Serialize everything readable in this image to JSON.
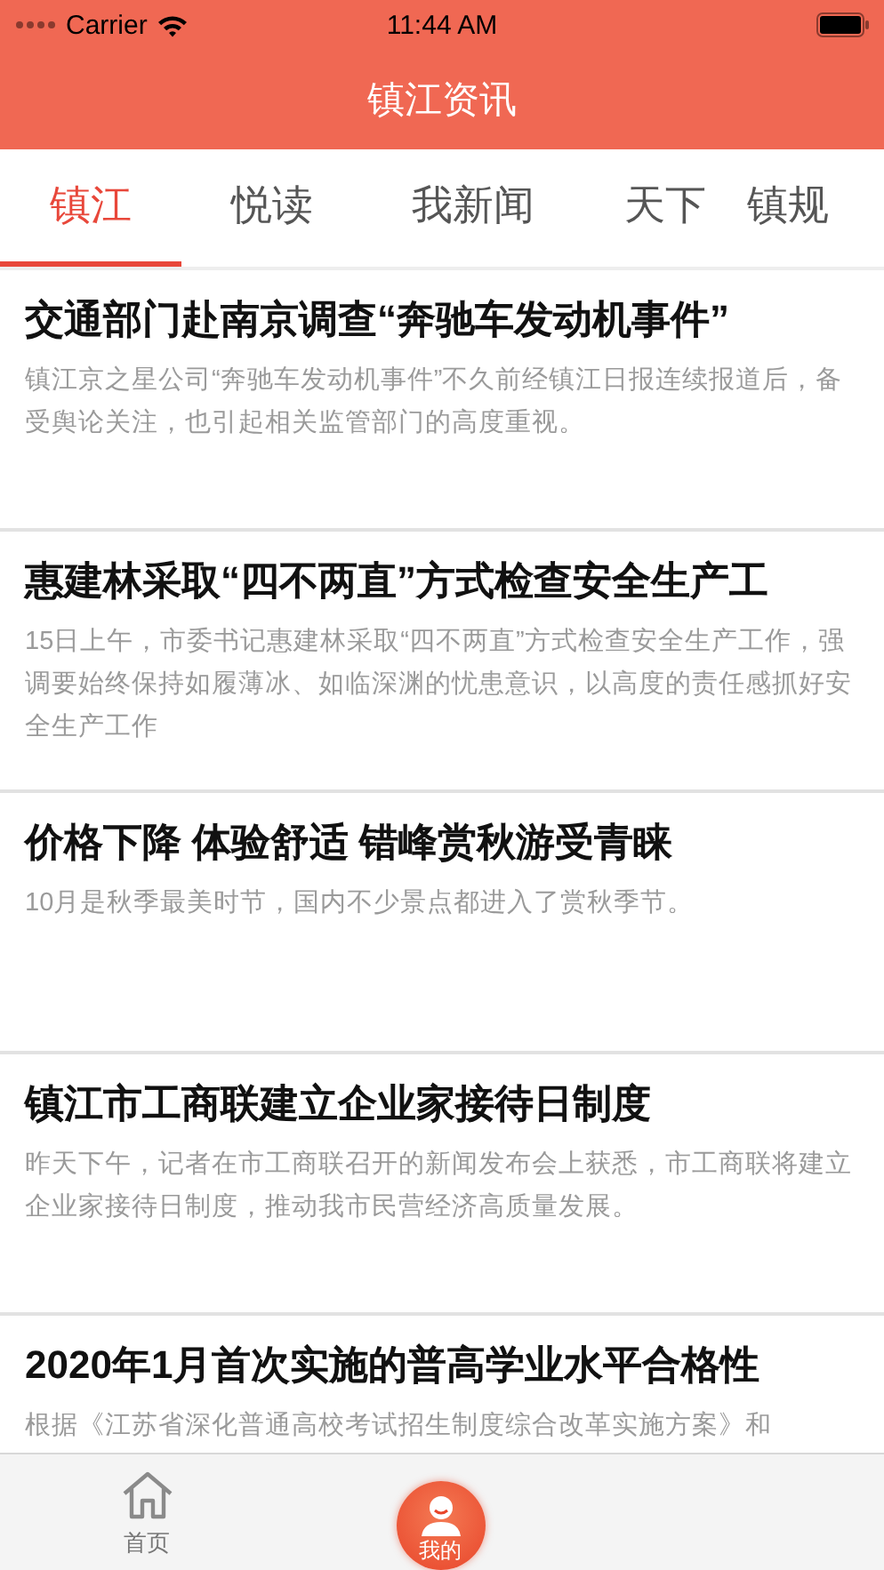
{
  "status_bar": {
    "carrier": "Carrier",
    "time": "11:44 AM"
  },
  "nav": {
    "title": "镇江资讯"
  },
  "tabs": [
    {
      "label": "镇江",
      "selected": true
    },
    {
      "label": "悦读",
      "selected": false
    },
    {
      "label": "我新闻",
      "selected": false
    },
    {
      "label": "天下",
      "selected": false
    },
    {
      "label": "镇规",
      "selected": false
    }
  ],
  "articles": [
    {
      "title": "交通部门赴南京调查“奔驰车发动机事件”",
      "summary": "镇江京之星公司“奔驰车发动机事件”不久前经镇江日报连续报道后，备受舆论关注，也引起相关监管部门的高度重视。"
    },
    {
      "title": "惠建林采取“四不两直”方式检查安全生产工",
      "summary": "15日上午，市委书记惠建林采取“四不两直”方式检查安全生产工作，强调要始终保持如履薄冰、如临深渊的忧患意识，以高度的责任感抓好安全生产工作"
    },
    {
      "title": "价格下降 体验舒适 错峰赏秋游受青睐",
      "summary": "10月是秋季最美时节，国内不少景点都进入了赏秋季节。"
    },
    {
      "title": "镇江市工商联建立企业家接待日制度",
      "summary": "昨天下午，记者在市工商联召开的新闻发布会上获悉，市工商联将建立企业家接待日制度，推动我市民营经济高质量发展。"
    },
    {
      "title": "2020年1月首次实施的普高学业水平合格性",
      "summary": "根据《江苏省深化普通高校考试招生制度综合改革实施方案》和"
    }
  ],
  "bottom_tabs": [
    {
      "label": "首页",
      "kind": "normal"
    },
    {
      "label": "我的",
      "kind": "raised"
    }
  ]
}
